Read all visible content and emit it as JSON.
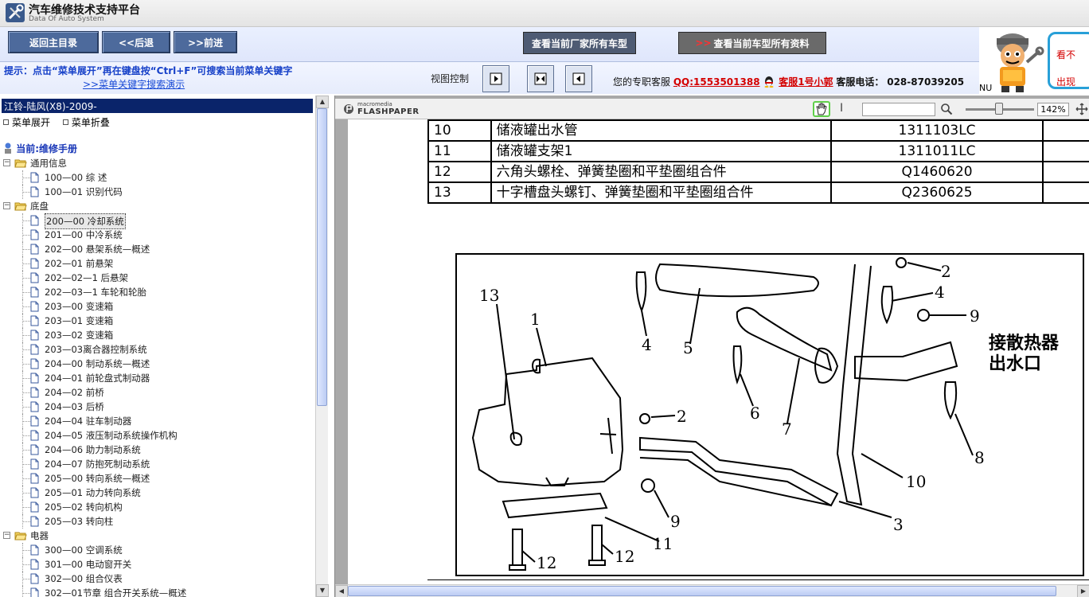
{
  "app": {
    "title": "汽车维修技术支持平台",
    "subtitle": "Data Of Auto System"
  },
  "toolbar": {
    "back_main": "返回主目录",
    "back": "<<后退",
    "forward": ">>前进",
    "view_all_models": "查看当前厂家所有车型",
    "view_all_docs": "查看当前车型所有资料"
  },
  "hint": {
    "text": "提示：点击“菜单展开”再在键盘按“Ctrl+F”可搜索当前菜单关键字",
    "link": ">>菜单关键字搜索演示"
  },
  "view_control": {
    "label": "视图控制"
  },
  "support": {
    "label": "您的专职客服",
    "qq": "QQ:1553501388",
    "agent": "客服1号小郭",
    "phone_label": "客服电话：",
    "phone": "028-87039205"
  },
  "ad": {
    "line1": "看不",
    "line2": "出现",
    "corner": "NU"
  },
  "left_panel": {
    "model": "江铃-陆风(X8)-2009-",
    "expand": "菜单展开",
    "collapse": "菜单折叠",
    "current": "当前:维修手册"
  },
  "tree": [
    {
      "type": "folder",
      "label": "通用信息"
    },
    {
      "type": "doc",
      "label": "100—00 综 述"
    },
    {
      "type": "doc",
      "label": "100—01 识别代码"
    },
    {
      "type": "folder",
      "label": "底盘"
    },
    {
      "type": "doc",
      "label": "200—00 冷却系统",
      "selected": true
    },
    {
      "type": "doc",
      "label": "201—00 中冷系统"
    },
    {
      "type": "doc",
      "label": "202—00 悬架系统—概述"
    },
    {
      "type": "doc",
      "label": "202—01 前悬架"
    },
    {
      "type": "doc",
      "label": "202—02—1 后悬架"
    },
    {
      "type": "doc",
      "label": "202—03—1 车轮和轮胎"
    },
    {
      "type": "doc",
      "label": "203—00 变速箱"
    },
    {
      "type": "doc",
      "label": "203—01 变速箱"
    },
    {
      "type": "doc",
      "label": "203—02 变速箱"
    },
    {
      "type": "doc",
      "label": "203—03离合器控制系统"
    },
    {
      "type": "doc",
      "label": "204—00 制动系统—概述"
    },
    {
      "type": "doc",
      "label": "204—01 前轮盘式制动器"
    },
    {
      "type": "doc",
      "label": "204—02 前桥"
    },
    {
      "type": "doc",
      "label": "204—03 后桥"
    },
    {
      "type": "doc",
      "label": "204—04 驻车制动器"
    },
    {
      "type": "doc",
      "label": "204—05 液压制动系统操作机构"
    },
    {
      "type": "doc",
      "label": "204—06 助力制动系统"
    },
    {
      "type": "doc",
      "label": "204—07 防抱死制动系统"
    },
    {
      "type": "doc",
      "label": "205—00 转向系统—概述"
    },
    {
      "type": "doc",
      "label": "205—01 动力转向系统"
    },
    {
      "type": "doc",
      "label": "205—02 转向机构"
    },
    {
      "type": "doc",
      "label": "205—03 转向柱"
    },
    {
      "type": "folder",
      "label": "电器"
    },
    {
      "type": "doc",
      "label": "300—00 空调系统"
    },
    {
      "type": "doc",
      "label": "301—00 电动窗开关"
    },
    {
      "type": "doc",
      "label": "302—00 组合仪表"
    },
    {
      "type": "doc",
      "label": "302—01节章 组合开关系统—概述"
    }
  ],
  "viewer": {
    "brand_top": "macromedia",
    "brand_bottom": "FLASHPAPER",
    "zoom": "142%",
    "cursor_tool": "I"
  },
  "parts_table": [
    {
      "no": "10",
      "name": "储液罐出水管",
      "code": "1311103LC"
    },
    {
      "no": "11",
      "name": "储液罐支架1",
      "code": "1311011LC"
    },
    {
      "no": "12",
      "name": "六角头螺栓、弹簧垫圈和平垫圈组合件",
      "code": "Q1460620"
    },
    {
      "no": "13",
      "name": "十字槽盘头螺钉、弹簧垫圈和平垫圈组合件",
      "code": "Q2360625"
    }
  ],
  "diagram": {
    "labels": [
      "13",
      "1",
      "4",
      "5",
      "2",
      "4",
      "9",
      "6",
      "7",
      "2",
      "8",
      "10",
      "9",
      "3",
      "11",
      "12",
      "12"
    ],
    "annotation_line1": "接散热器",
    "annotation_line2": "出水口"
  }
}
